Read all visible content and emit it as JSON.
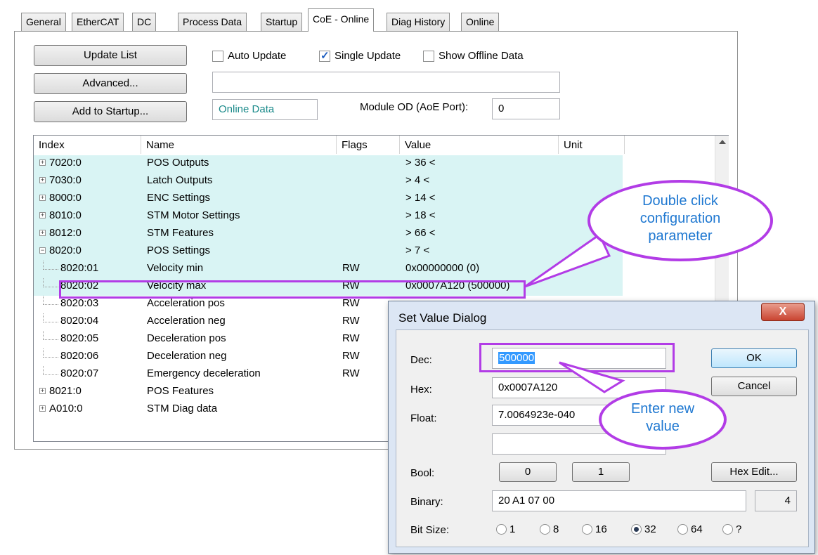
{
  "tabs": [
    "General",
    "EtherCAT",
    "DC",
    "Process Data",
    "Startup",
    "CoE - Online",
    "Diag History",
    "Online"
  ],
  "active_tab": "CoE - Online",
  "buttons": {
    "update_list": "Update List",
    "advanced": "Advanced...",
    "add_to_startup": "Add to Startup..."
  },
  "checkboxes": [
    {
      "label": "Auto Update",
      "checked": false
    },
    {
      "label": "Single Update",
      "checked": true
    },
    {
      "label": "Show Offline Data",
      "checked": false
    }
  ],
  "online_data": "Online Data",
  "module_od_label": "Module OD (AoE Port):",
  "module_od_value": "0",
  "columns": [
    "Index",
    "Name",
    "Flags",
    "Value",
    "Unit"
  ],
  "rows": [
    {
      "index": "7020:0",
      "name": "POS Outputs",
      "flags": "",
      "value": "> 36 <",
      "expand": "+",
      "child": false
    },
    {
      "index": "7030:0",
      "name": "Latch Outputs",
      "flags": "",
      "value": "> 4 <",
      "expand": "+",
      "child": false
    },
    {
      "index": "8000:0",
      "name": "ENC Settings",
      "flags": "",
      "value": "> 14 <",
      "expand": "+",
      "child": false
    },
    {
      "index": "8010:0",
      "name": "STM Motor Settings",
      "flags": "",
      "value": "> 18 <",
      "expand": "+",
      "child": false
    },
    {
      "index": "8012:0",
      "name": "STM Features",
      "flags": "",
      "value": "> 66 <",
      "expand": "+",
      "child": false
    },
    {
      "index": "8020:0",
      "name": "POS Settings",
      "flags": "",
      "value": "> 7 <",
      "expand": "−",
      "child": false
    },
    {
      "index": "8020:01",
      "name": "Velocity min",
      "flags": "RW",
      "value": "0x00000000 (0)",
      "expand": "",
      "child": true
    },
    {
      "index": "8020:02",
      "name": "Velocity max",
      "flags": "RW",
      "value": "0x0007A120 (500000)",
      "expand": "",
      "child": true
    },
    {
      "index": "8020:03",
      "name": "Acceleration pos",
      "flags": "RW",
      "value": "",
      "expand": "",
      "child": true
    },
    {
      "index": "8020:04",
      "name": "Acceleration neg",
      "flags": "RW",
      "value": "",
      "expand": "",
      "child": true
    },
    {
      "index": "8020:05",
      "name": "Deceleration pos",
      "flags": "RW",
      "value": "",
      "expand": "",
      "child": true
    },
    {
      "index": "8020:06",
      "name": "Deceleration neg",
      "flags": "RW",
      "value": "",
      "expand": "",
      "child": true
    },
    {
      "index": "8020:07",
      "name": "Emergency deceleration",
      "flags": "RW",
      "value": "",
      "expand": "",
      "child": true
    },
    {
      "index": "8021:0",
      "name": "POS Features",
      "flags": "",
      "value": "",
      "expand": "+",
      "child": false
    },
    {
      "index": "A010:0",
      "name": "STM Diag data",
      "flags": "",
      "value": "",
      "expand": "+",
      "child": false
    }
  ],
  "callouts": {
    "double_click": [
      "Double click",
      "configuration",
      "parameter"
    ],
    "enter_value": [
      "Enter new",
      "value"
    ]
  },
  "dialog": {
    "title": "Set Value Dialog",
    "close": "X",
    "dec_label": "Dec:",
    "dec_value": "500000",
    "hex_label": "Hex:",
    "hex_value": "0x0007A120",
    "float_label": "Float:",
    "float_value": "7.0064923e-040",
    "bool_label": "Bool:",
    "bool_0": "0",
    "bool_1": "1",
    "hex_edit": "Hex Edit...",
    "binary_label": "Binary:",
    "binary_value": "20 A1 07 00",
    "binary_len": "4",
    "bitsize_label": "Bit Size:",
    "bit_sizes": [
      {
        "label": "1",
        "selected": false
      },
      {
        "label": "8",
        "selected": false
      },
      {
        "label": "16",
        "selected": false
      },
      {
        "label": "32",
        "selected": true
      },
      {
        "label": "64",
        "selected": false
      },
      {
        "label": "?",
        "selected": false
      }
    ],
    "ok": "OK",
    "cancel": "Cancel"
  },
  "colors": {
    "callout_border": "#b23ce6",
    "callout_text": "#1f78d1",
    "row_highlight": "#d9f4f4"
  }
}
